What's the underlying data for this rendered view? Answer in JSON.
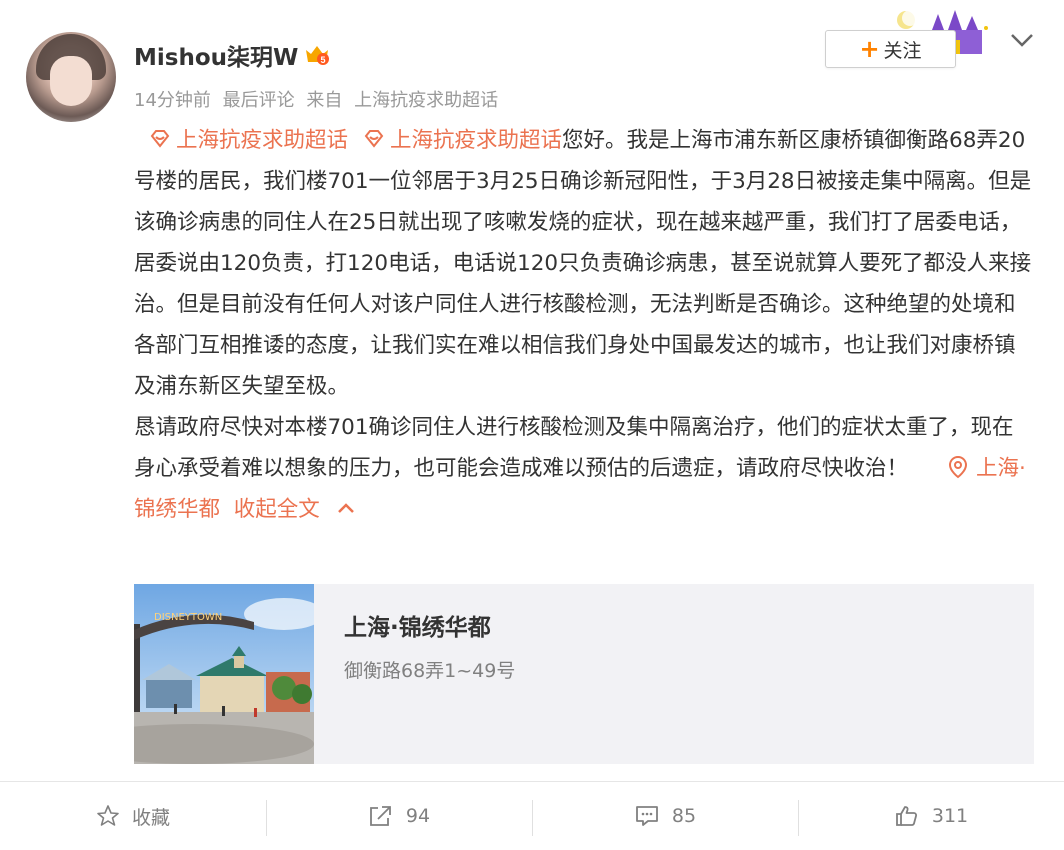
{
  "user": {
    "name": "Mishou柒玥W",
    "badge_number": "5"
  },
  "meta": {
    "time": "14分钟前",
    "last_comment": "最后评论",
    "from_label": "来自",
    "source": "上海抗疫求助超话"
  },
  "follow": {
    "plus": "+",
    "label": "关注"
  },
  "post": {
    "topic1": "上海抗疫求助超话",
    "topic2": "上海抗疫求助超话",
    "para1": "您好。我是上海市浦东新区康桥镇御衡路68弄20号楼的居民，我们楼701一位邻居于3月25日确诊新冠阳性，于3月28日被接走集中隔离。但是该确诊病患的同住人在25日就出现了咳嗽发烧的症状，现在越来越严重，我们打了居委电话，居委说由120负责，打120电话，电话说120只负责确诊病患，甚至说就算人要死了都没人来接治。但是目前没有任何人对该户同住人进行核酸检测，无法判断是否确诊。这种绝望的处境和各部门互相推诿的态度，让我们实在难以相信我们身处中国最发达的城市，也让我们对康桥镇及浦东新区失望至极。",
    "para2": "恳请政府尽快对本楼701确诊同住人进行核酸检测及集中隔离治疗，他们的症状太重了，现在身心承受着难以想象的压力，也可能会造成难以预估的后遗症，请政府尽快收治！",
    "location": "上海·锦绣华都",
    "collapse": "收起全文"
  },
  "card": {
    "title": "上海·锦绣华都",
    "address": "御衡路68弄1~49号",
    "sign_text": "DISNEYTOWN"
  },
  "actions": {
    "favorite": "收藏",
    "repost": "94",
    "comment": "85",
    "like": "311"
  },
  "colors": {
    "accent": "#eb7350",
    "follow_plus": "#ff8200",
    "muted": "#999999",
    "card_bg": "#f2f2f5"
  }
}
